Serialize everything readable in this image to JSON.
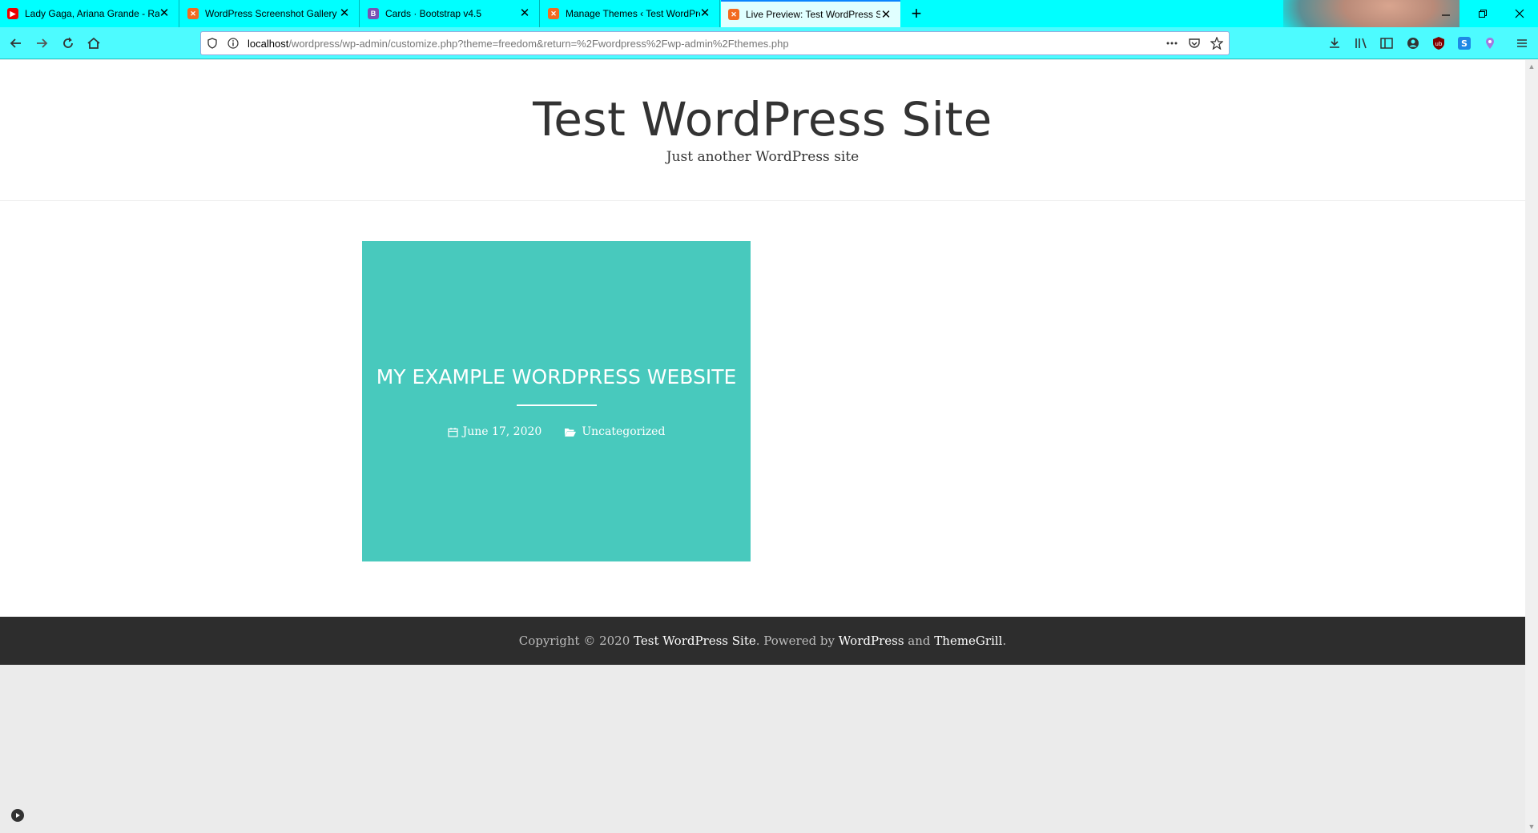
{
  "browser": {
    "tabs": [
      {
        "title": "Lady Gaga, Ariana Grande - Rain On Me",
        "favicon": "youtube-icon"
      },
      {
        "title": "WordPress Screenshot Gallery",
        "favicon": "xampp-icon"
      },
      {
        "title": "Cards · Bootstrap v4.5",
        "favicon": "bootstrap-icon"
      },
      {
        "title": "Manage Themes ‹ Test WordPress Site",
        "favicon": "xampp-icon"
      },
      {
        "title": "Live Preview: Test WordPress Site",
        "favicon": "xampp-icon",
        "active": true
      }
    ],
    "url_host": "localhost",
    "url_path": "/wordpress/wp-admin/customize.php?theme=freedom&return=%2Fwordpress%2Fwp-admin%2Fthemes.php",
    "accent_color": "#00ffff"
  },
  "site": {
    "title": "Test WordPress Site",
    "description": "Just another WordPress site"
  },
  "post": {
    "title": "MY EXAMPLE WORDPRESS WEBSITE",
    "date": "June 17, 2020",
    "category": "Uncategorized",
    "card_color": "#48c9bd"
  },
  "footer": {
    "prefix": "Copyright © 2020 ",
    "site_link": "Test WordPress Site",
    "powered": ". Powered by ",
    "wp_link": "WordPress",
    "and": " and ",
    "theme_link": "ThemeGrill",
    "suffix": "."
  }
}
